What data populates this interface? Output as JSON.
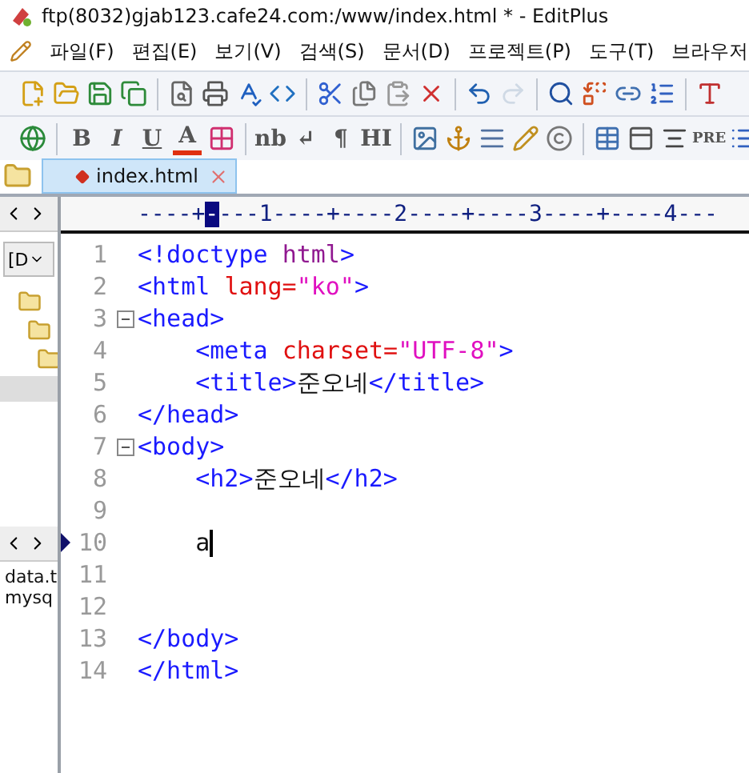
{
  "window": {
    "title": "ftp(8032)gjab123.cafe24.com:/www/index.html * - EditPlus"
  },
  "menu": [
    "파일(F)",
    "편집(E)",
    "보기(V)",
    "검색(S)",
    "문서(D)",
    "프로젝트(P)",
    "도구(T)",
    "브라우저"
  ],
  "toolbar_main": [
    {
      "kind": "icon",
      "disabled": false
    },
    {
      "kind": "icon",
      "disabled": false
    },
    {
      "kind": "icon",
      "disabled": false
    },
    {
      "kind": "icon",
      "disabled": false
    },
    {
      "kind": "separator"
    },
    {
      "kind": "icon",
      "disabled": false
    },
    {
      "kind": "icon",
      "disabled": false
    },
    {
      "kind": "icon",
      "disabled": false
    },
    {
      "kind": "icon",
      "disabled": false
    },
    {
      "kind": "separator"
    },
    {
      "kind": "icon",
      "disabled": false
    },
    {
      "kind": "icon",
      "disabled": false
    },
    {
      "kind": "icon",
      "disabled": false
    },
    {
      "kind": "icon",
      "disabled": false
    },
    {
      "kind": "separator"
    },
    {
      "kind": "icon",
      "disabled": false
    },
    {
      "kind": "icon",
      "disabled": true
    },
    {
      "kind": "separator"
    },
    {
      "kind": "icon",
      "disabled": false
    },
    {
      "kind": "icon",
      "disabled": false
    },
    {
      "kind": "icon",
      "disabled": false
    },
    {
      "kind": "icon",
      "disabled": false
    },
    {
      "kind": "separator"
    },
    {
      "kind": "icon",
      "disabled": false
    }
  ],
  "toolbar_html": [
    {
      "kind": "icon"
    },
    {
      "kind": "separator"
    },
    {
      "kind": "glyph",
      "label": "B"
    },
    {
      "kind": "glyph",
      "label": "I"
    },
    {
      "kind": "glyph",
      "label": "U"
    },
    {
      "kind": "glyph",
      "label": "A"
    },
    {
      "kind": "icon"
    },
    {
      "kind": "separator"
    },
    {
      "kind": "glyph",
      "label": "nb"
    },
    {
      "kind": "glyph",
      "label": "↵"
    },
    {
      "kind": "glyph",
      "label": "¶"
    },
    {
      "kind": "glyph",
      "label": "HI"
    },
    {
      "kind": "separator"
    },
    {
      "kind": "icon"
    },
    {
      "kind": "icon"
    },
    {
      "kind": "icon"
    },
    {
      "kind": "icon"
    },
    {
      "kind": "icon"
    },
    {
      "kind": "separator"
    },
    {
      "kind": "icon"
    },
    {
      "kind": "icon"
    },
    {
      "kind": "icon"
    },
    {
      "kind": "glyph",
      "label": "PRE"
    },
    {
      "kind": "icon"
    }
  ],
  "tabs": [
    {
      "label": "index.html",
      "selected": true
    }
  ],
  "sidebar": {
    "drive": "[D",
    "files": [
      "data.t",
      "mysq"
    ]
  },
  "ruler": [
    {
      "text": "----+",
      "selected": false
    },
    {
      "text": "-",
      "selected": true
    },
    {
      "text": "---1----+----2----+----3----+----4---",
      "selected": false
    }
  ],
  "lines": [
    {
      "number": "1",
      "fold": false,
      "current": false,
      "tokens": [
        {
          "kind": "tag",
          "text": "<!doctype "
        },
        {
          "kind": "doctype",
          "text": "html"
        },
        {
          "kind": "tag",
          "text": ">"
        }
      ]
    },
    {
      "number": "2",
      "fold": false,
      "current": false,
      "tokens": [
        {
          "kind": "tag",
          "text": "<html "
        },
        {
          "kind": "attr",
          "text": "lang="
        },
        {
          "kind": "string",
          "text": "\"ko\""
        },
        {
          "kind": "tag",
          "text": ">"
        }
      ]
    },
    {
      "number": "3",
      "fold": true,
      "current": false,
      "tokens": [
        {
          "kind": "tag",
          "text": "<head>"
        }
      ]
    },
    {
      "number": "4",
      "fold": false,
      "current": false,
      "tokens": [
        {
          "kind": "tag",
          "text": "    <meta "
        },
        {
          "kind": "attr",
          "text": "charset="
        },
        {
          "kind": "string",
          "text": "\"UTF-8\""
        },
        {
          "kind": "tag",
          "text": ">"
        }
      ]
    },
    {
      "number": "5",
      "fold": false,
      "current": false,
      "tokens": [
        {
          "kind": "tag",
          "text": "    <title>"
        },
        {
          "kind": "text",
          "text": "준오네"
        },
        {
          "kind": "tag",
          "text": "</title>"
        }
      ]
    },
    {
      "number": "6",
      "fold": false,
      "current": false,
      "tokens": [
        {
          "kind": "tag",
          "text": "</head>"
        }
      ]
    },
    {
      "number": "7",
      "fold": true,
      "current": false,
      "tokens": [
        {
          "kind": "tag",
          "text": "<body>"
        }
      ]
    },
    {
      "number": "8",
      "fold": false,
      "current": false,
      "tokens": [
        {
          "kind": "tag",
          "text": "    <h2>"
        },
        {
          "kind": "text",
          "text": "준오네"
        },
        {
          "kind": "tag",
          "text": "</h2>"
        }
      ]
    },
    {
      "number": "9",
      "fold": false,
      "current": false
    },
    {
      "number": "10",
      "fold": false,
      "current": true,
      "tokens": [
        {
          "kind": "text",
          "text": "    a"
        }
      ]
    },
    {
      "number": "11",
      "fold": false,
      "current": false
    },
    {
      "number": "12",
      "fold": false,
      "current": false
    },
    {
      "number": "13",
      "fold": false,
      "current": false,
      "tokens": [
        {
          "kind": "tag",
          "text": "</body>"
        }
      ]
    },
    {
      "number": "14",
      "fold": false,
      "current": false,
      "tokens": [
        {
          "kind": "tag",
          "text": "</html>"
        }
      ]
    }
  ]
}
